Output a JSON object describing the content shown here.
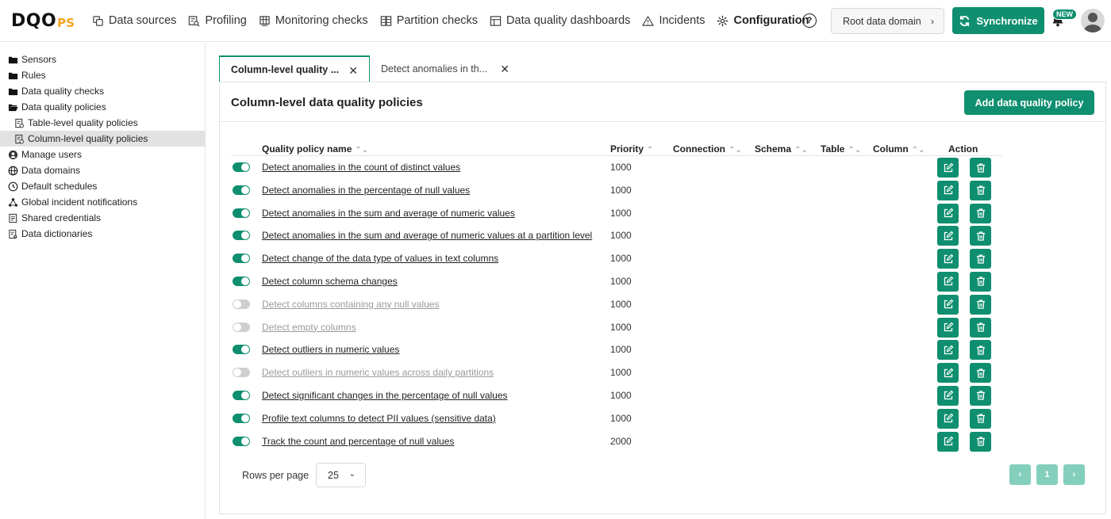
{
  "logo": {
    "main": "DQO",
    "suffix": "PS"
  },
  "nav": [
    {
      "label": "Data sources",
      "icon": "data-sources-icon"
    },
    {
      "label": "Profiling",
      "icon": "profiling-icon"
    },
    {
      "label": "Monitoring checks",
      "icon": "monitoring-icon"
    },
    {
      "label": "Partition checks",
      "icon": "partition-icon"
    },
    {
      "label": "Data quality dashboards",
      "icon": "dashboard-icon"
    },
    {
      "label": "Incidents",
      "icon": "warning-icon"
    },
    {
      "label": "Configuration",
      "icon": "gear-icon"
    }
  ],
  "header": {
    "help": "?",
    "domain_label": "Root data domain",
    "sync_label": "Synchronize",
    "new_badge": "NEW"
  },
  "sidebar": {
    "items": [
      {
        "label": "Sensors",
        "icon": "folder-icon"
      },
      {
        "label": "Rules",
        "icon": "folder-icon"
      },
      {
        "label": "Data quality checks",
        "icon": "folder-icon"
      },
      {
        "label": "Data quality policies",
        "icon": "folder-open-icon"
      },
      {
        "label": "Table-level quality policies",
        "icon": "policy-file-icon"
      },
      {
        "label": "Column-level quality policies",
        "icon": "policy-file-icon"
      },
      {
        "label": "Manage users",
        "icon": "user-icon"
      },
      {
        "label": "Data domains",
        "icon": "globe-icon"
      },
      {
        "label": "Default schedules",
        "icon": "clock-icon"
      },
      {
        "label": "Global incident notifications",
        "icon": "network-icon"
      },
      {
        "label": "Shared credentials",
        "icon": "credentials-icon"
      },
      {
        "label": "Data dictionaries",
        "icon": "dictionary-icon"
      }
    ]
  },
  "tabs": [
    {
      "label": "Column-level quality ...",
      "active": true
    },
    {
      "label": "Detect anomalies in th...",
      "active": false
    }
  ],
  "panel": {
    "title": "Column-level data quality policies",
    "add_label": "Add data quality policy"
  },
  "table": {
    "headers": {
      "name": "Quality policy name",
      "priority": "Priority",
      "connection": "Connection",
      "schema": "Schema",
      "table": "Table",
      "column": "Column",
      "action": "Action"
    },
    "rows": [
      {
        "name": "Detect anomalies in the count of distinct values",
        "priority": "1000",
        "enabled": true
      },
      {
        "name": "Detect anomalies in the percentage of null values",
        "priority": "1000",
        "enabled": true
      },
      {
        "name": "Detect anomalies in the sum and average of numeric values",
        "priority": "1000",
        "enabled": true
      },
      {
        "name": "Detect anomalies in the sum and average of numeric values at a partition level",
        "priority": "1000",
        "enabled": true
      },
      {
        "name": "Detect change of the data type of values in text columns",
        "priority": "1000",
        "enabled": true
      },
      {
        "name": "Detect column schema changes",
        "priority": "1000",
        "enabled": true
      },
      {
        "name": "Detect columns containing any null values",
        "priority": "1000",
        "enabled": false
      },
      {
        "name": "Detect empty columns",
        "priority": "1000",
        "enabled": false
      },
      {
        "name": "Detect outliers in numeric values",
        "priority": "1000",
        "enabled": true
      },
      {
        "name": "Detect outliers in numeric values across daily partitions",
        "priority": "1000",
        "enabled": false
      },
      {
        "name": "Detect significant changes in the percentage of null values",
        "priority": "1000",
        "enabled": true
      },
      {
        "name": "Profile text columns to detect PII values (sensitive data)",
        "priority": "1000",
        "enabled": true
      },
      {
        "name": "Track the count and percentage of null values",
        "priority": "2000",
        "enabled": true
      }
    ]
  },
  "pagination": {
    "rows_per_page_label": "Rows per page",
    "rows_per_page_value": "25",
    "prev": "‹",
    "page": "1",
    "next": "›"
  },
  "colors": {
    "accent": "#0f8f6f",
    "accent_light": "#84cfbc",
    "logo_suffix": "#f4a21b"
  }
}
